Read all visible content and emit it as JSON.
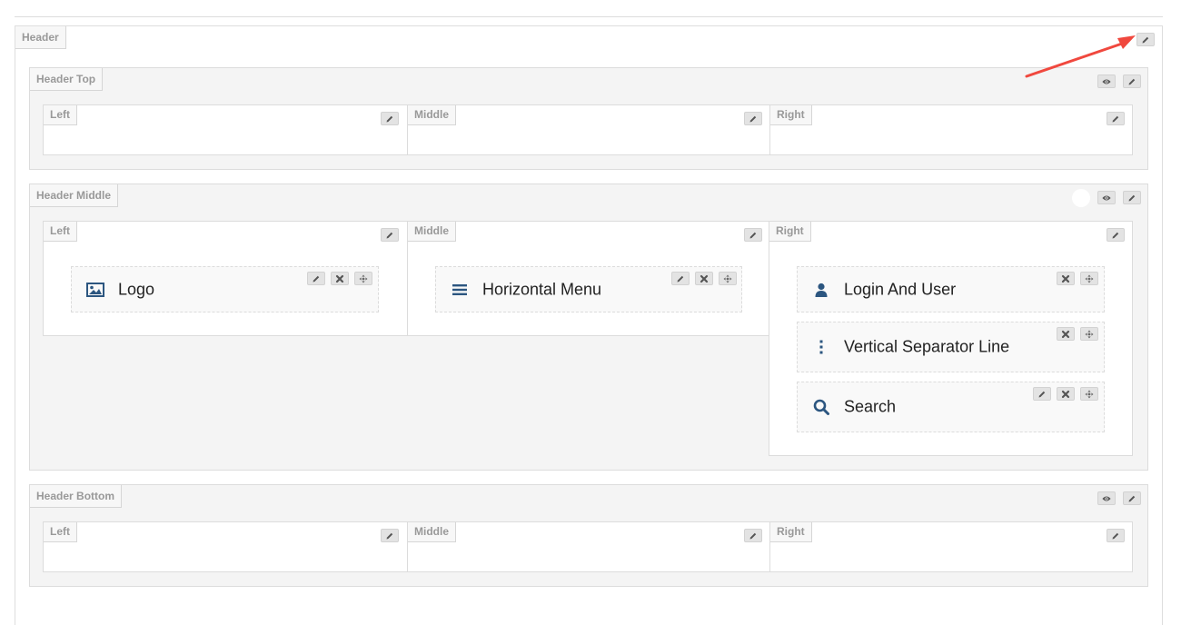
{
  "header": {
    "label": "Header",
    "sections": [
      {
        "label": "Header Top",
        "columns": [
          {
            "label": "Left"
          },
          {
            "label": "Middle"
          },
          {
            "label": "Right"
          }
        ]
      },
      {
        "label": "Header Middle",
        "columns": [
          {
            "label": "Left"
          },
          {
            "label": "Middle"
          },
          {
            "label": "Right"
          }
        ]
      },
      {
        "label": "Header Bottom",
        "columns": [
          {
            "label": "Left"
          },
          {
            "label": "Middle"
          },
          {
            "label": "Right"
          }
        ]
      }
    ]
  },
  "widgets": {
    "logo": {
      "label": "Logo",
      "icon": "image-icon"
    },
    "horizontal_menu": {
      "label": "Horizontal Menu",
      "icon": "bars-icon"
    },
    "login_and_user": {
      "label": "Login And User",
      "icon": "user-icon"
    },
    "vertical_separator_line": {
      "label": "Vertical Separator Line",
      "icon": "vertical-dots-icon"
    },
    "search": {
      "label": "Search",
      "icon": "search-icon"
    }
  },
  "colors": {
    "icon_blue": "#2c5680",
    "annotation_red": "#f0483e",
    "section_bg": "#f4f4f4"
  }
}
